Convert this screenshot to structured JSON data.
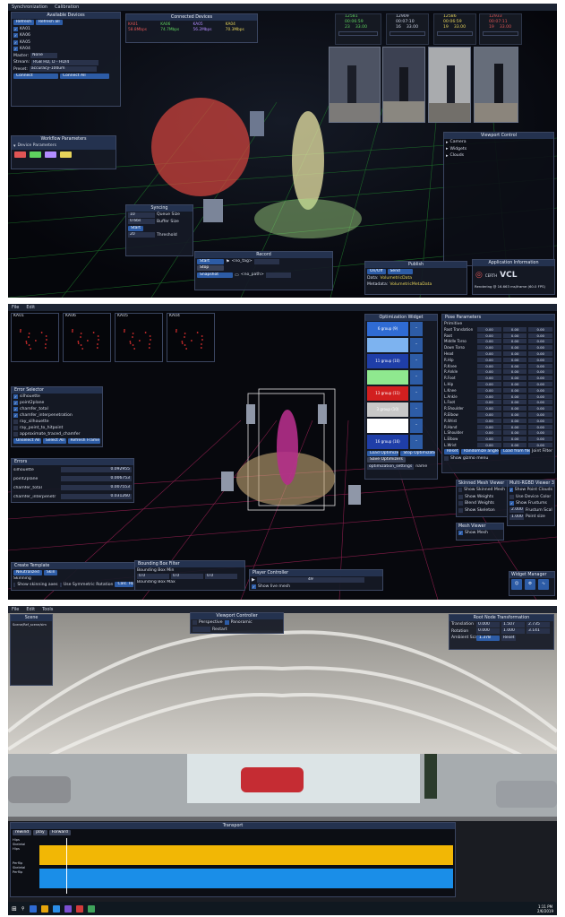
{
  "screen1": {
    "menu": [
      "Synchronization",
      "Calibration"
    ],
    "available_devices": {
      "title": "Available Devices",
      "refresh": "Refresh",
      "refresh_all": "Refresh all",
      "devices": [
        "KA01",
        "KA06",
        "KA05",
        "KA04"
      ],
      "master_label": "Master:",
      "master_value": "None",
      "stream_label": "Stream:",
      "stream_value": "RGB HD, D - HD/4",
      "preset_label": "Preset:",
      "preset_value": "accuracy-100um",
      "connect": "Connect",
      "connect_all": "Connect All"
    },
    "connected_devices": {
      "title": "Connected Devices",
      "devices": [
        {
          "name": "KA01",
          "rate": "58.8Mbps",
          "color": "#e05555"
        },
        {
          "name": "KA06",
          "rate": "74.7Mbps",
          "color": "#5fd35f"
        },
        {
          "name": "KA05",
          "rate": "56.2Mbps",
          "color": "#b38cff"
        },
        {
          "name": "KA04",
          "rate": "70.3Mbps",
          "color": "#e6d35a"
        }
      ]
    },
    "stats": [
      {
        "v1": "12581",
        "t1": "00:06:59",
        "a": "23",
        "b": "33.00",
        "color": "#5fd35f"
      },
      {
        "v1": "12909",
        "t1": "00:07:10",
        "a": "16",
        "b": "33.00",
        "color": "#cfd6e6"
      },
      {
        "v1": "12586",
        "t1": "00:06:59",
        "a": "19",
        "b": "33.00",
        "color": "#e6d35a"
      },
      {
        "v1": "12933",
        "t1": "00:07:11",
        "a": "19",
        "b": "33.00",
        "color": "#e05555"
      }
    ],
    "workflow": {
      "title": "Workflow Parameters",
      "device_params": "Device Parameters",
      "chips": [
        "#e05555",
        "#5fd35f",
        "#b38cff",
        "#e6d35a"
      ]
    },
    "viewport": {
      "title": "Viewport Control",
      "items": [
        "Camera",
        "Widgets",
        "Clouds"
      ]
    },
    "syncing": {
      "title": "Syncing",
      "queue_val": "10",
      "queue_label": "Queue Size",
      "buffer_val": "0.6bs",
      "buffer_label": "Buffer Size",
      "start": "Start",
      "threshold_val": "20",
      "threshold_label": "Threshold"
    },
    "record": {
      "title": "Record",
      "start": "Start",
      "stop": "Stop",
      "snapshot": "Snapshot",
      "tag": "<no_tag>",
      "path": "<no_path>"
    },
    "publish": {
      "title": "Publish",
      "onoff": "On/Off",
      "send": "Send",
      "data_label": "Data:",
      "data_value": "VolumetricData",
      "meta_label": "Metadata:",
      "meta_value": "VolumetricMetaData"
    },
    "appinfo": {
      "title": "Application Information",
      "logo_left": "CERTH",
      "logo_right": "VCL",
      "sub": "Centre for Research & Technology",
      "render": "Rendering @ 16.663 ms/frame (60.0 FPS)"
    }
  },
  "screen2": {
    "menu": [
      "File",
      "Edit"
    ],
    "thumbs": [
      "KA01",
      "KA06",
      "KA05",
      "KA04"
    ],
    "error_selector": {
      "title": "Error Selector",
      "items": [
        {
          "label": "silhouette",
          "on": true
        },
        {
          "label": "point2plane",
          "on": true
        },
        {
          "label": "chamfer_total",
          "on": true
        },
        {
          "label": "chamfer_interpenetration",
          "on": true
        },
        {
          "label": "ray_silhouette",
          "on": false
        },
        {
          "label": "ray_point_to_hitpoint",
          "on": false
        },
        {
          "label": "approximate_traced_chamfer",
          "on": false
        }
      ],
      "buttons": [
        "Unselect All",
        "Select All",
        "Refresh Frame"
      ]
    },
    "errors": {
      "title": "Errors",
      "rows": [
        {
          "name": "silhouette",
          "value": "0.092955"
        },
        {
          "name": "point2plane",
          "value": "0.006753"
        },
        {
          "name": "chamfer_total",
          "value": "0.007553"
        },
        {
          "name": "chamfer_interpenetr",
          "value": "0.031260"
        }
      ]
    },
    "optimization": {
      "title": "Optimization Widget",
      "groups": [
        {
          "label": "6 group (9)",
          "color": "#2f6bd3"
        },
        {
          "label": "",
          "color": "#7db3f0"
        },
        {
          "label": "11 group (10)",
          "color": "#1f3ea8"
        },
        {
          "label": "",
          "color": "#8fe88f"
        },
        {
          "label": "13 group (11)",
          "color": "#d21f1f"
        },
        {
          "label": "3 group (10)",
          "color": "#c8c8c8"
        },
        {
          "label": "",
          "color": "#ffffff"
        },
        {
          "label": "16 group (16)",
          "color": "#1f3ea8"
        }
      ],
      "buttons": [
        "Load Optimizers",
        "Stop Optimization",
        "Save Optimizers"
      ],
      "settings": "optimization_settings",
      "name": "name"
    },
    "pose": {
      "title": "Pose Parameters",
      "sub": "Primitive",
      "rows": [
        {
          "name": "Root Translation",
          "a": "0.00",
          "b": "0.00",
          "c": "0.00"
        },
        {
          "name": "Root",
          "a": "0.00",
          "b": "0.00",
          "c": "0.00"
        },
        {
          "name": "Middle Torso",
          "a": "0.00",
          "b": "0.00",
          "c": "0.00"
        },
        {
          "name": "Down Torso",
          "a": "0.00",
          "b": "0.00",
          "c": "0.00"
        },
        {
          "name": "Head",
          "a": "0.00",
          "b": "0.00",
          "c": "0.00"
        },
        {
          "name": "R.Hip",
          "a": "0.00",
          "b": "0.00",
          "c": "0.00"
        },
        {
          "name": "R.Knee",
          "a": "0.00",
          "b": "0.00",
          "c": "0.00"
        },
        {
          "name": "R.Ankle",
          "a": "0.00",
          "b": "0.00",
          "c": "0.00"
        },
        {
          "name": "R.Foot",
          "a": "0.00",
          "b": "0.00",
          "c": "0.00"
        },
        {
          "name": "L.Hip",
          "a": "0.00",
          "b": "0.00",
          "c": "0.00"
        },
        {
          "name": "L.Knee",
          "a": "0.00",
          "b": "0.00",
          "c": "0.00"
        },
        {
          "name": "L.Ankle",
          "a": "0.00",
          "b": "0.00",
          "c": "0.00"
        },
        {
          "name": "L.Foot",
          "a": "0.00",
          "b": "0.00",
          "c": "0.00"
        },
        {
          "name": "R.Shoulder",
          "a": "0.00",
          "b": "0.00",
          "c": "0.00"
        },
        {
          "name": "R.Elbow",
          "a": "0.00",
          "b": "0.00",
          "c": "0.00"
        },
        {
          "name": "R.Wrist",
          "a": "0.00",
          "b": "0.00",
          "c": "0.00"
        },
        {
          "name": "R.Hand",
          "a": "0.00",
          "b": "0.00",
          "c": "0.00"
        },
        {
          "name": "L.Shoulder",
          "a": "0.00",
          "b": "0.00",
          "c": "0.00"
        },
        {
          "name": "L.Elbow",
          "a": "0.00",
          "b": "0.00",
          "c": "0.00"
        },
        {
          "name": "L.Wrist",
          "a": "0.00",
          "b": "0.00",
          "c": "0.00"
        }
      ],
      "buttons": [
        "Reset",
        "Randomize angles",
        "Load from file",
        "Joint Filter"
      ],
      "show_gizmo": "Show gizmo menu"
    },
    "skinned": {
      "title": "Skinned Mesh Viewer",
      "items": [
        "Show Skinned Mesh",
        "Show Weights",
        "Blend Weights",
        "Show Skeleton"
      ]
    },
    "multi": {
      "title": "Multi-RGBD Viewer 3D",
      "items": [
        "Show Point Clouds",
        "Use Device Color",
        "Show Frustums"
      ],
      "frustum_val": "2.000",
      "frustum_label": "Frustum Scal",
      "point_val": "1.000",
      "point_label": "Point size"
    },
    "mesh_viewer": {
      "title": "Mesh Viewer",
      "item": "Show Mesh"
    },
    "template": {
      "title": "Create Template",
      "a": "Neutralized",
      "b": "Skin",
      "skinning": "Skinning",
      "show_skinning": "Show skinning axes",
      "use_sym": "Use Symmetric Rotation",
      "calc": "Calc. Rotation"
    },
    "bbox": {
      "title": "Bounding Box Filter",
      "min": "Bounding Box Min",
      "max": "Bounding Box Max",
      "min_vals": [
        "0.0",
        "0.0",
        "0.0"
      ],
      "max_vals": [
        "0.0",
        "0.0",
        "0.0"
      ]
    },
    "player": {
      "title": "Player Controller",
      "frame": "49",
      "show_live": "Show live mesh"
    },
    "widget_mgr": {
      "title": "Widget Manager"
    }
  },
  "screen3": {
    "menu": [
      "File",
      "Edit",
      "Tools"
    ],
    "scene": {
      "title": "Scene",
      "item": "Scene/Ref_scene/sim"
    },
    "viewport": {
      "title": "Viewport Controller",
      "persp": "Perspective",
      "pano": "Panoramic",
      "restart": "Restart"
    },
    "transform": {
      "title": "Root Node Transformation",
      "translation": "Translation",
      "rotation": "Rotation",
      "ambient": "Ambient Scaling",
      "t": [
        "0.000",
        "1.507",
        "2.735"
      ],
      "r": [
        "0.000",
        "1.000",
        "3.141"
      ],
      "scale": "1.378",
      "reset": "Reset"
    },
    "transport": {
      "title": "Transport",
      "buttons": [
        "rewind",
        "play",
        "Forward"
      ],
      "tracks": [
        "Hips",
        "Skeletal",
        "Hips",
        "Perflip",
        "Skeletal",
        "Perflip"
      ],
      "colors": [
        "#f2b705",
        "#1a8ee8"
      ]
    },
    "taskbar": {
      "time": "1:11 PM",
      "date": "2/6/2019"
    }
  }
}
